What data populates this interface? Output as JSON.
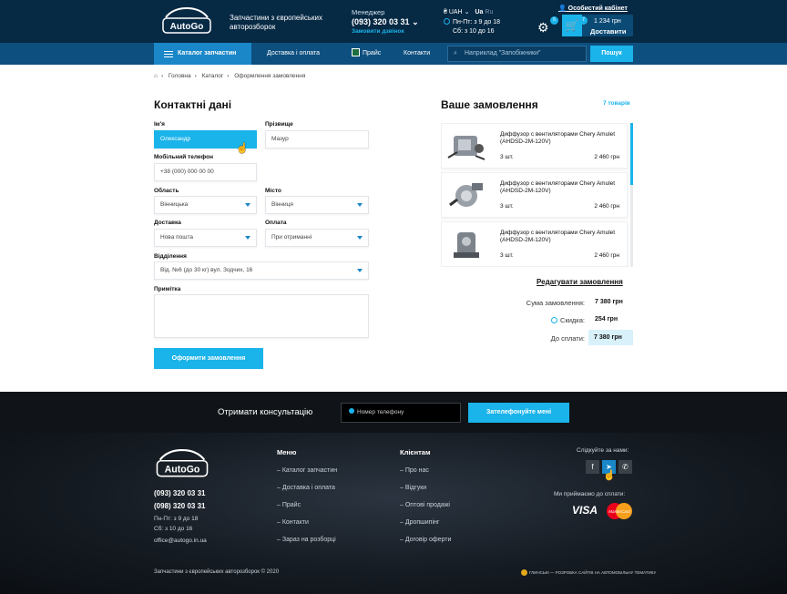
{
  "header": {
    "brand_logo_text": "AutoGo",
    "tagline": "Запчастини з європейських авторозборок",
    "manager_label": "Менеджер",
    "manager_phone": "(093) 320 03 31",
    "callback_link": "Замовити дзвінок",
    "currency": "₴ UAH",
    "lang_active": "Ua",
    "lang_other": "Ru",
    "hours_1": "Пн-Пт: з 9 до 18",
    "hours_2": "Сб: з 10 до 16",
    "gear_badge": "5",
    "cabinet_link": "Особистий кабінет",
    "cart_badge": "7",
    "cart_total": "1 234 грн",
    "cart_label": "Доставити"
  },
  "nav": {
    "catalog": "Каталог запчастин",
    "delivery": "Доставка і оплата",
    "price": "Прайс",
    "contacts": "Контакти",
    "search_placeholder": "Наприклад \"Запобіжники\"",
    "search_button": "Пошук"
  },
  "breadcrumb": [
    "Головна",
    "Каталог",
    "Оформлення замовлення"
  ],
  "form": {
    "title": "Контактні дані",
    "first_name_label": "Ім'я",
    "first_name_value": "Олександр",
    "last_name_label": "Прізвище",
    "last_name_value": "Мазур",
    "phone_label": "Мобільний телефон",
    "phone_value": "+38 (000) 000 00 00",
    "region_label": "Область",
    "region_value": "Вінницька",
    "city_label": "Місто",
    "city_value": "Вінниця",
    "delivery_label": "Доставка",
    "delivery_value": "Нова пошта",
    "payment_label": "Оплата",
    "payment_value": "При отриманні",
    "branch_label": "Відділення",
    "branch_value": "Від. №6 (до 30 кг) вул. Зодчих, 16",
    "note_label": "Примітка",
    "submit": "Оформити замовлення"
  },
  "order": {
    "title": "Ваше замовлення",
    "count": "7 товарів",
    "items": [
      {
        "name": "Диффузор с вентиляторами Chery Amulet (AHDSD-2M-120V)",
        "qty": "3 шт.",
        "price": "2 460 грн"
      },
      {
        "name": "Диффузор с вентиляторами Chery Amulet (AHDSD-2M-120V)",
        "qty": "3 шт.",
        "price": "2 460 грн"
      },
      {
        "name": "Диффузор с вентиляторами Chery Amulet (AHDSD-2M-120V)",
        "qty": "3 шт.",
        "price": "2 460 грн"
      }
    ],
    "edit_link": "Редагувати замовлення",
    "sum_label": "Сума замовлення:",
    "sum_value": "7 380 грн",
    "discount_label": "Скидка:",
    "discount_value": "254 грн",
    "total_label": "До сплати:",
    "total_value": "7 380 грн"
  },
  "cta": {
    "title": "Отримати консультацію",
    "phone_placeholder": "Номер телефону",
    "button": "Зателефонуйте мені"
  },
  "footer": {
    "logo_text": "AutoGo",
    "phone_1": "(093) 320 03 31",
    "phone_2": "(098) 320 03 31",
    "hours_1": "Пн-Пт: з 9 до 18",
    "hours_2": "Сб: з 10 до 16",
    "email": "office@autogo.in.ua",
    "menu_title": "Меню",
    "menu": [
      "– Каталог запчастин",
      "– Доставка і оплата",
      "– Прайс",
      "– Контакти",
      "– Зараз на розборці"
    ],
    "clients_title": "Клієнтам",
    "clients": [
      "– Про нас",
      "– Відгуки",
      "– Оптові продажі",
      "– Дропшипінг",
      "– Договір оферти"
    ],
    "follow": "Слідкуйте за нами:",
    "payments_label": "Ми приймаємо до сплати:",
    "visa": "VISA",
    "mastercard": "MasterCard",
    "copyright": "Запчастини з європейських авторозборок © 2020",
    "developer": "ГЛИНСЬКІ — РОЗРОБКА САЙТІВ НА АВТОМОБІЛЬНУ ТЕМАТИКУ"
  },
  "colors": {
    "accent": "#1ab3ea",
    "header_bg": "#062944",
    "nav_bg": "#0d4f7f"
  }
}
